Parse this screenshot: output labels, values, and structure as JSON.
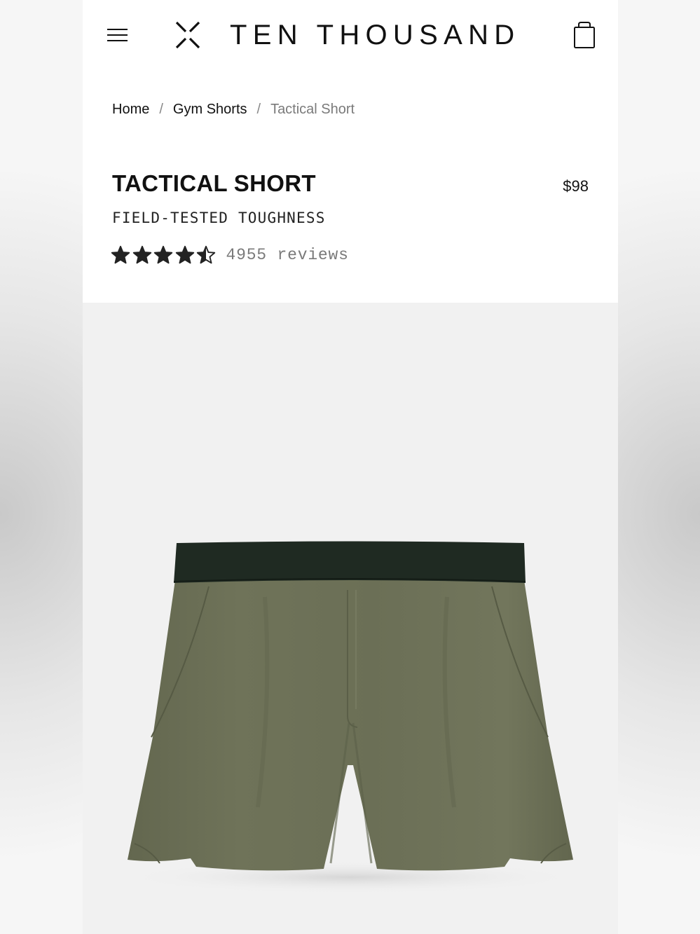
{
  "brand": {
    "name": "TEN THOUSAND"
  },
  "header": {
    "menu_icon": "hamburger-menu-icon",
    "logo_icon": "ten-thousand-x-logo-icon",
    "cart_icon": "shopping-bag-icon"
  },
  "breadcrumb": {
    "items": [
      "Home",
      "Gym Shorts",
      "Tactical Short"
    ],
    "separator": "/"
  },
  "product": {
    "title": "TACTICAL SHORT",
    "tagline": "FIELD-TESTED TOUGHNESS",
    "price": "$98",
    "rating": 4.5,
    "rating_max": 5,
    "reviews": "4955 reviews",
    "image_icon": "olive-green-shorts-product-image"
  },
  "colors": {
    "short_body": "#6d7159",
    "waistband": "#1f2a22",
    "image_background": "#f1f1f1",
    "text": "#111111",
    "muted_text": "#7a7a7a"
  }
}
